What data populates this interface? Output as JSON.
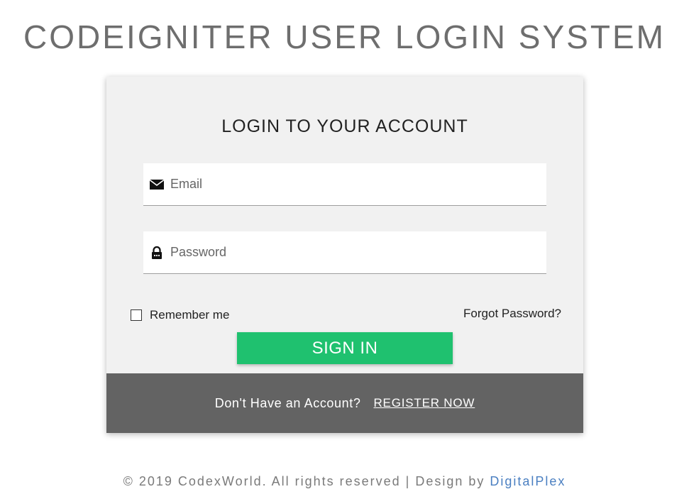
{
  "header": {
    "title": "CODEIGNITER USER LOGIN SYSTEM"
  },
  "login_card": {
    "title": "LOGIN TO YOUR ACCOUNT",
    "email": {
      "icon": "envelope-icon",
      "placeholder": "Email",
      "value": ""
    },
    "password": {
      "icon": "lock-icon",
      "placeholder": "Password",
      "value": ""
    },
    "remember_label": "Remember me",
    "remember_checked": false,
    "forgot_label": "Forgot Password?",
    "signin_label": "SIGN IN",
    "signin_color": "#1fc16f"
  },
  "card_footer": {
    "text": "Don't Have an Account?",
    "register_label": "REGISTER NOW",
    "background": "#636363"
  },
  "footer": {
    "copyright": "© 2019 CodexWorld. All rights reserved | Design by",
    "designer_link": "DigitalPlex"
  }
}
